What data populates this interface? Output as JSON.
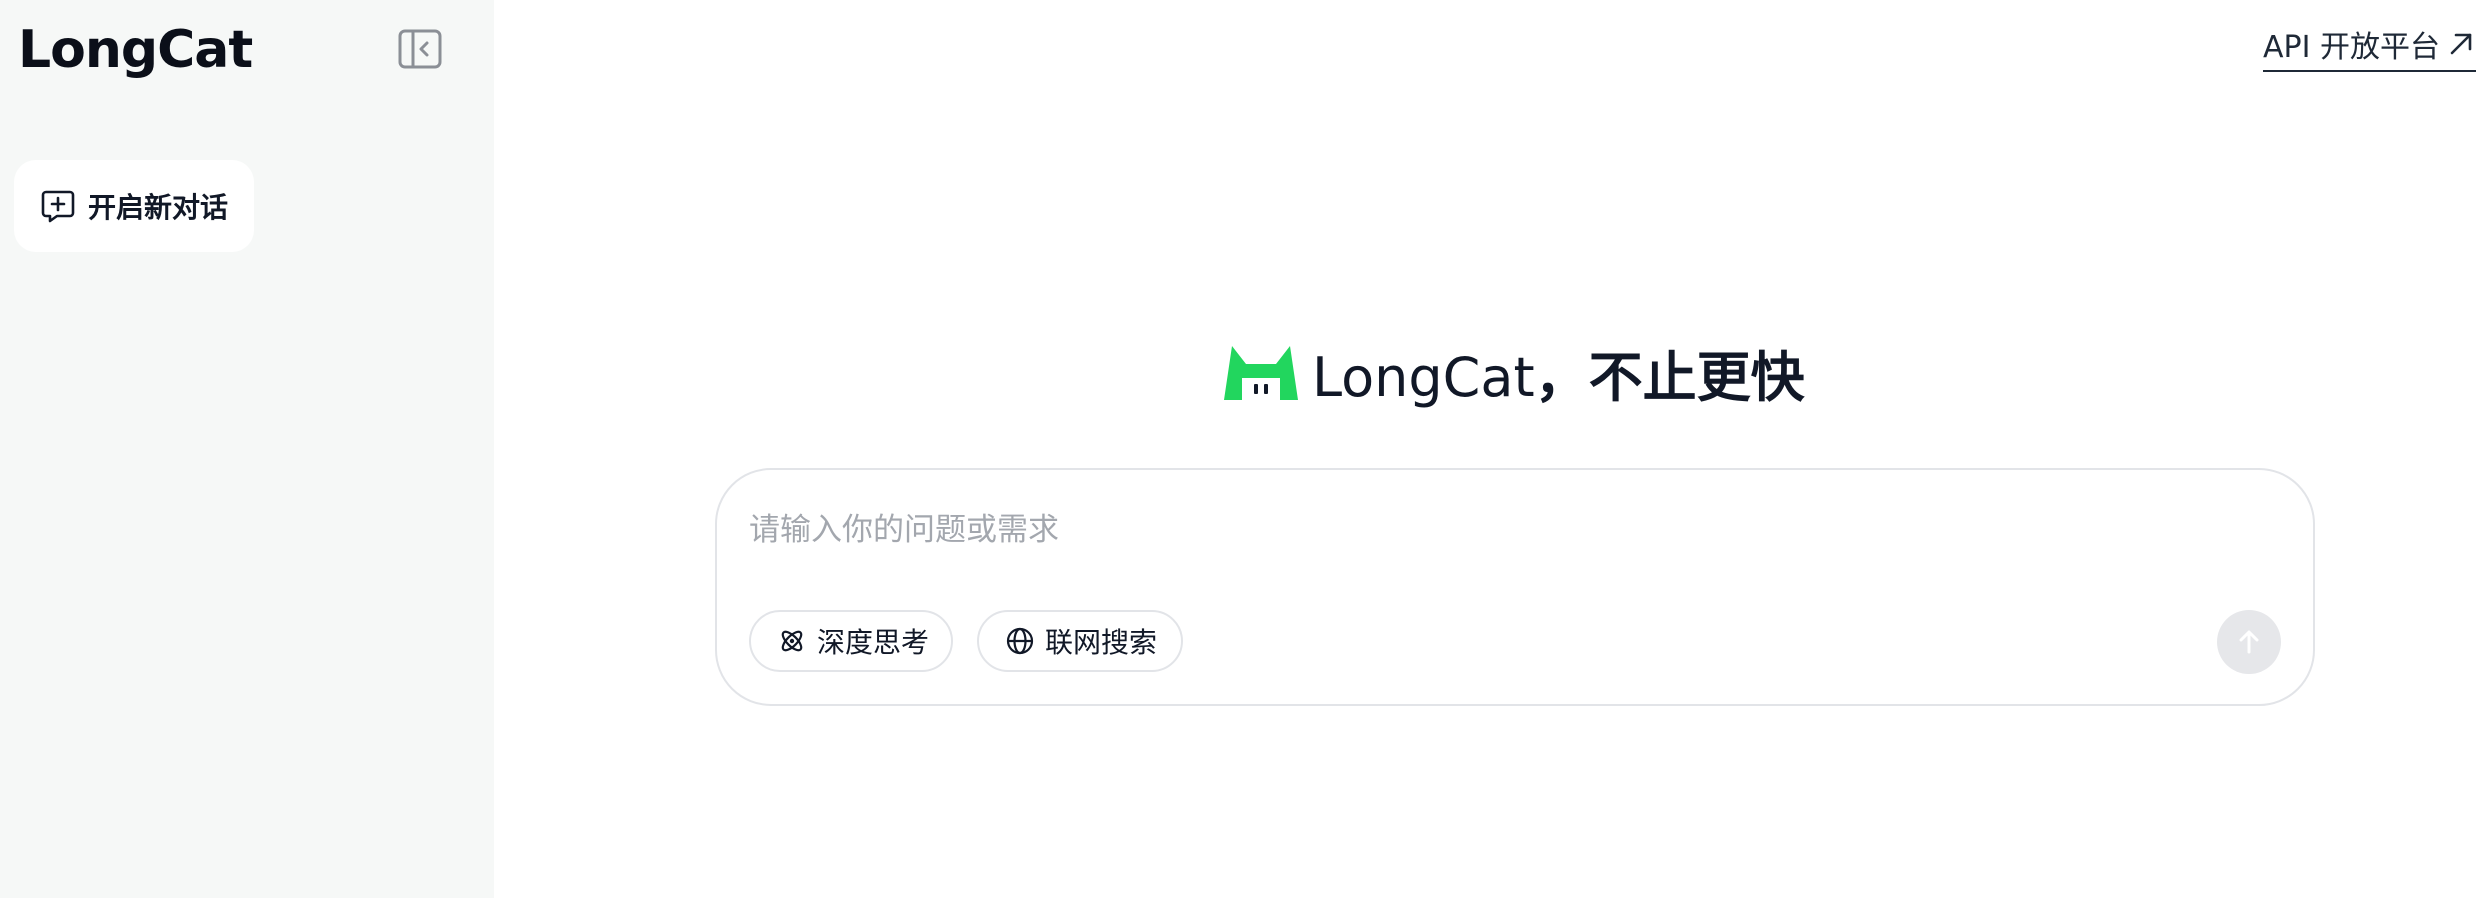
{
  "sidebar": {
    "brand": "LongCat",
    "collapse_icon": "sidebar-collapse-icon",
    "new_chat_label": "开启新对话",
    "new_chat_icon": "chat-plus-icon"
  },
  "header": {
    "api_link_label": "API 开放平台",
    "api_link_icon": "arrow-up-right-icon"
  },
  "hero": {
    "logo_icon": "longcat-logo-icon",
    "brand_text": "LongCat",
    "slogan": "，不止更快",
    "logo_color": "#22d65e"
  },
  "composer": {
    "placeholder": "请输入你的问题或需求",
    "value": "",
    "chips": [
      {
        "label": "深度思考",
        "icon": "atom-icon"
      },
      {
        "label": "联网搜索",
        "icon": "globe-icon"
      }
    ],
    "send_icon": "arrow-up-icon"
  }
}
